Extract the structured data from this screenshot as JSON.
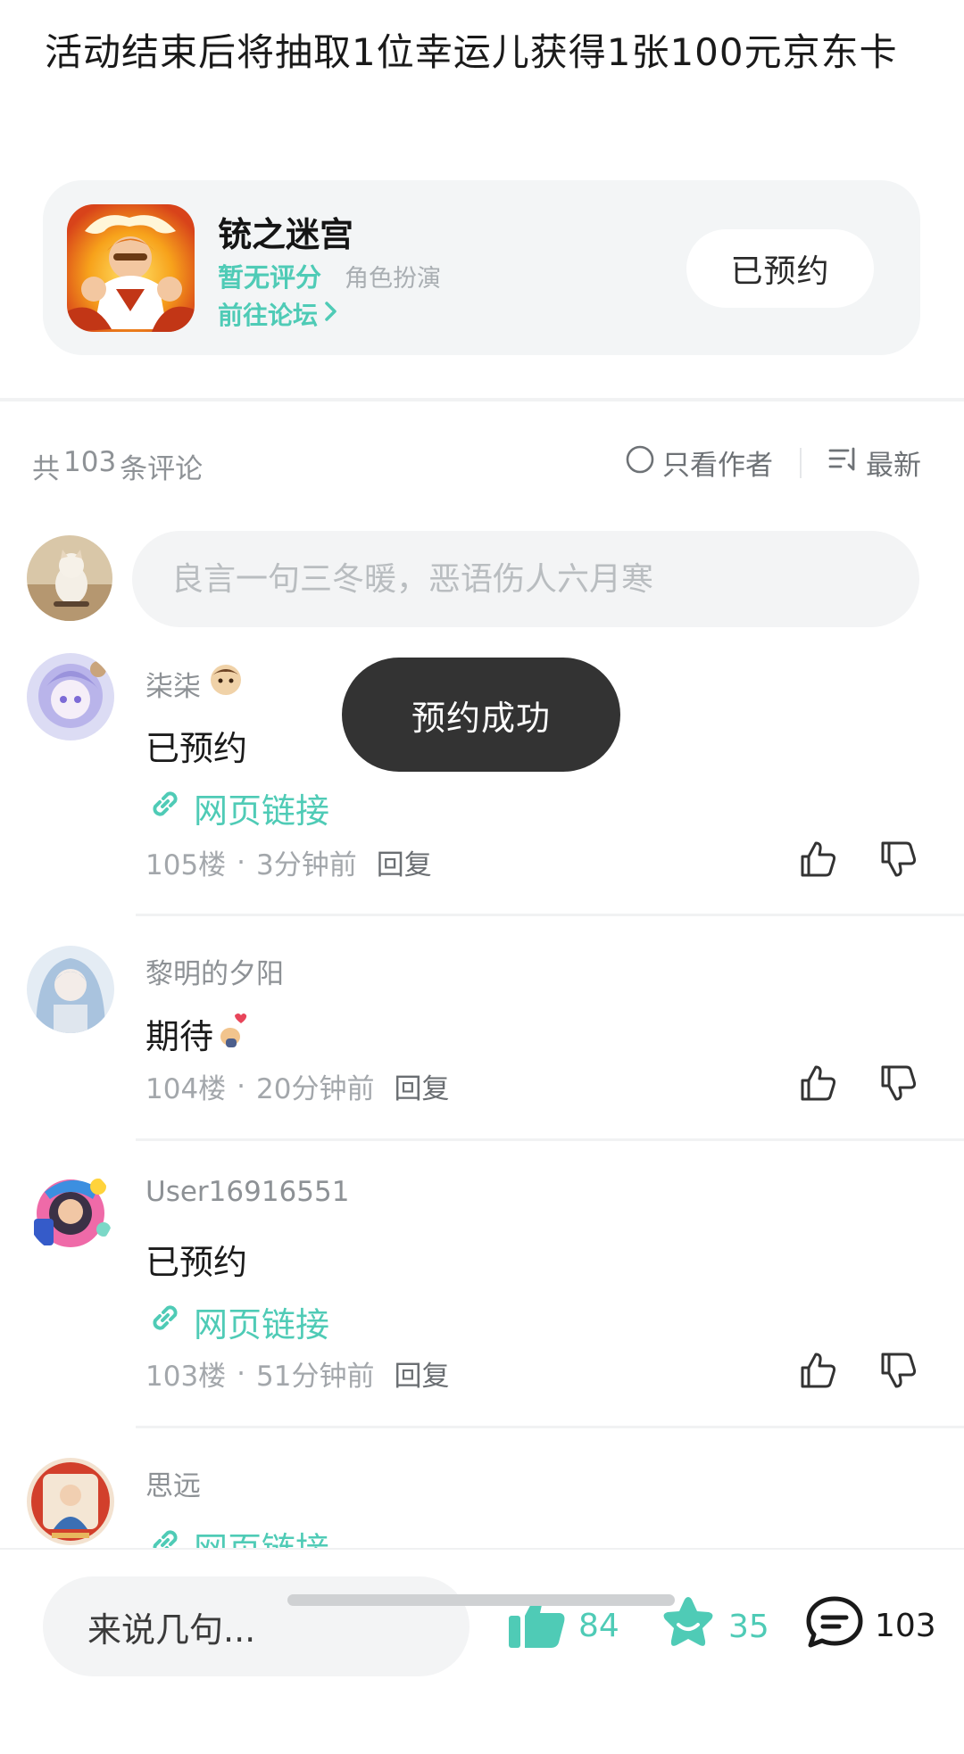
{
  "post": {
    "text": "活动结束后将抽取1位幸运儿获得1张100元京东卡"
  },
  "game_card": {
    "title": "铳之迷宫",
    "rating": "暂无评分",
    "genre": "角色扮演",
    "forum_link": "前往论坛",
    "reserve_button": "已预约"
  },
  "comments_header": {
    "count_prefix": "共",
    "count": "103",
    "count_suffix": "条评论",
    "author_only": "只看作者",
    "sort": "最新"
  },
  "comment_input": {
    "placeholder": "良言一句三冬暖，恶语伤人六月寒"
  },
  "comments": [
    {
      "user": "柒柒",
      "text": "已预约",
      "link": "网页链接",
      "floor": "105楼",
      "time": "3分钟前",
      "reply": "回复"
    },
    {
      "user": "黎明的夕阳",
      "text": "期待",
      "floor": "104楼",
      "time": "20分钟前",
      "reply": "回复"
    },
    {
      "user": "User16916551",
      "text": "已预约",
      "link": "网页链接",
      "floor": "103楼",
      "time": "51分钟前",
      "reply": "回复"
    },
    {
      "user": "思远",
      "link": "网页链接"
    }
  ],
  "toast": {
    "message": "预约成功"
  },
  "bottom_bar": {
    "input_placeholder": "来说几句...",
    "likes": "84",
    "favorites": "35",
    "comments": "103"
  },
  "colors": {
    "accent": "#4fcbb6",
    "toast_bg": "#333333"
  }
}
